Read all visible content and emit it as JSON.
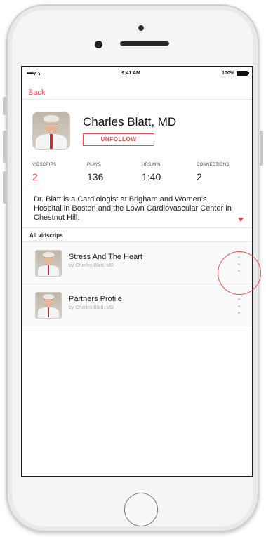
{
  "status_bar": {
    "carrier": "•••••",
    "time": "9:41 AM",
    "battery": "100%"
  },
  "nav": {
    "back_label": "Back"
  },
  "profile": {
    "name": "Charles Blatt, MD",
    "unfollow_label": "UNFOLLOW"
  },
  "stats": [
    {
      "label": "VIDSCRIPS",
      "value": "2"
    },
    {
      "label": "PLAYS",
      "value": "136"
    },
    {
      "label": "HRS:MIN",
      "value": "1:40"
    },
    {
      "label": "CONNECTIONS",
      "value": "2"
    }
  ],
  "bio": "Dr. Blatt is a Cardiologist at Brigham and Women's Hospital in Boston and the Lown Cardiovascular Center in Chestnut Hill.",
  "section": {
    "title": "All vidscrips"
  },
  "videos": [
    {
      "title": "Stress And The Heart",
      "byline": "by Charles Blatt, MD"
    },
    {
      "title": "Partners Profile",
      "byline": "by Charles Blatt, MD"
    }
  ],
  "colors": {
    "accent": "#e94b4b",
    "frame": "#f5f5f5"
  }
}
